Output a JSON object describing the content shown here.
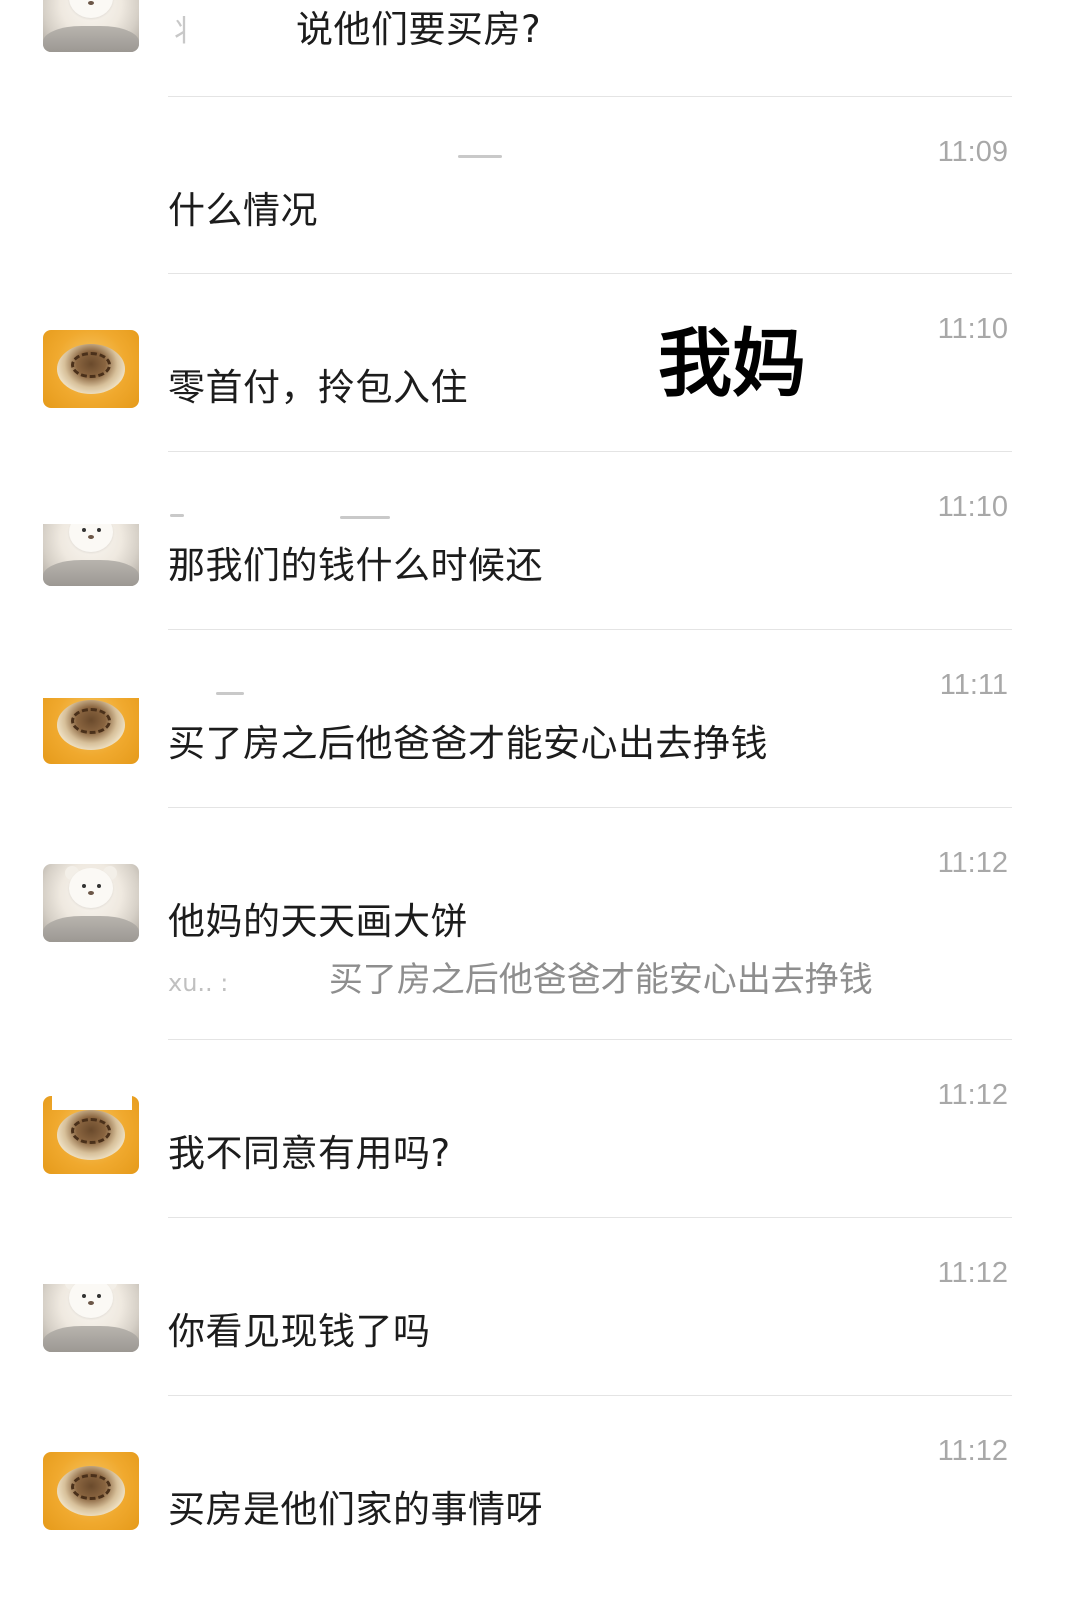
{
  "messages": [
    {
      "id": "m0",
      "avatar": "bear",
      "time": "",
      "text": "说他们要买房?",
      "name_prefix": "丬"
    },
    {
      "id": "m1",
      "avatar": "none",
      "time": "11:09",
      "text": "什么情况"
    },
    {
      "id": "m2",
      "avatar": "coffee",
      "time": "11:10",
      "text": "零首付，拎包入住"
    },
    {
      "id": "m3",
      "avatar": "bear",
      "time": "11:10",
      "text": "那我们的钱什么时候还"
    },
    {
      "id": "m4",
      "avatar": "coffee",
      "time": "11:11",
      "text": "买了房之后他爸爸才能安心出去挣钱"
    },
    {
      "id": "m5",
      "avatar": "bear",
      "time": "11:12",
      "text": "他妈的天天画大饼",
      "quote": {
        "name": "xu.. :",
        "text": "买了房之后他爸爸才能安心出去挣钱"
      }
    },
    {
      "id": "m6",
      "avatar": "coffee",
      "time": "11:12",
      "text": "我不同意有用吗?"
    },
    {
      "id": "m7",
      "avatar": "bear",
      "time": "11:12",
      "text": "你看见现钱了吗"
    },
    {
      "id": "m8",
      "avatar": "coffee",
      "time": "11:12",
      "text": "买房是他们家的事情呀"
    }
  ],
  "overlay_label": "我妈",
  "colors": {
    "background": "#ffffff",
    "text": "#1c1c1c",
    "time": "#a8a8a8",
    "divider": "#e4e4e4",
    "quote": "#8e8e8e"
  }
}
